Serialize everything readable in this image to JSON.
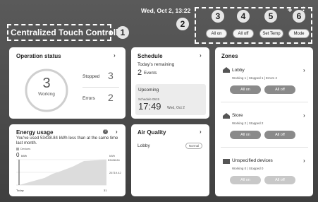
{
  "header": {
    "datetime": "Wed, Oct 2, 13:22",
    "title": "Centralized Touch Controller",
    "buttons": [
      "All on",
      "All off",
      "Set Temp",
      "Mode"
    ]
  },
  "badges": [
    "1",
    "2",
    "3",
    "4",
    "5",
    "6"
  ],
  "operation": {
    "title": "Operation status",
    "working_count": "3",
    "working_label": "Working",
    "stopped_label": "Stopped",
    "stopped_count": "3",
    "errors_label": "Errors",
    "errors_count": "2"
  },
  "schedule": {
    "title": "Schedule",
    "remaining_label": "Today's remaining",
    "events_count": "2",
    "events_label": "Events",
    "upcoming_label": "Upcoming",
    "upcoming_name": "Schedule 0615",
    "upcoming_time": "17:49",
    "upcoming_date": "Wed, Oct 2"
  },
  "zones": {
    "title": "Zones",
    "items": [
      {
        "name": "Lobby",
        "status": "Working 1 | Stopped 1 | Errors 2",
        "on": "All on",
        "off": "All off"
      },
      {
        "name": "Store",
        "status": "Working 2 | Stopped 2",
        "on": "All on",
        "off": "All off"
      },
      {
        "name": "Unspecified devices",
        "status": "Working 0 | Stopped 0",
        "on": "All on",
        "off": "All off"
      }
    ]
  },
  "energy": {
    "title": "Energy usage",
    "message": "You've used 53438.84 kWh less than at the same time last month.",
    "legend": "Devices",
    "big_value": "0",
    "big_unit": "kWh",
    "right_labels": [
      "kWh",
      "53438.84"
    ],
    "mid_label": "26719.42",
    "x_start": "Today",
    "x_end": "31"
  },
  "air": {
    "title": "Air Quality",
    "location": "Lobby",
    "status": "Normal"
  }
}
